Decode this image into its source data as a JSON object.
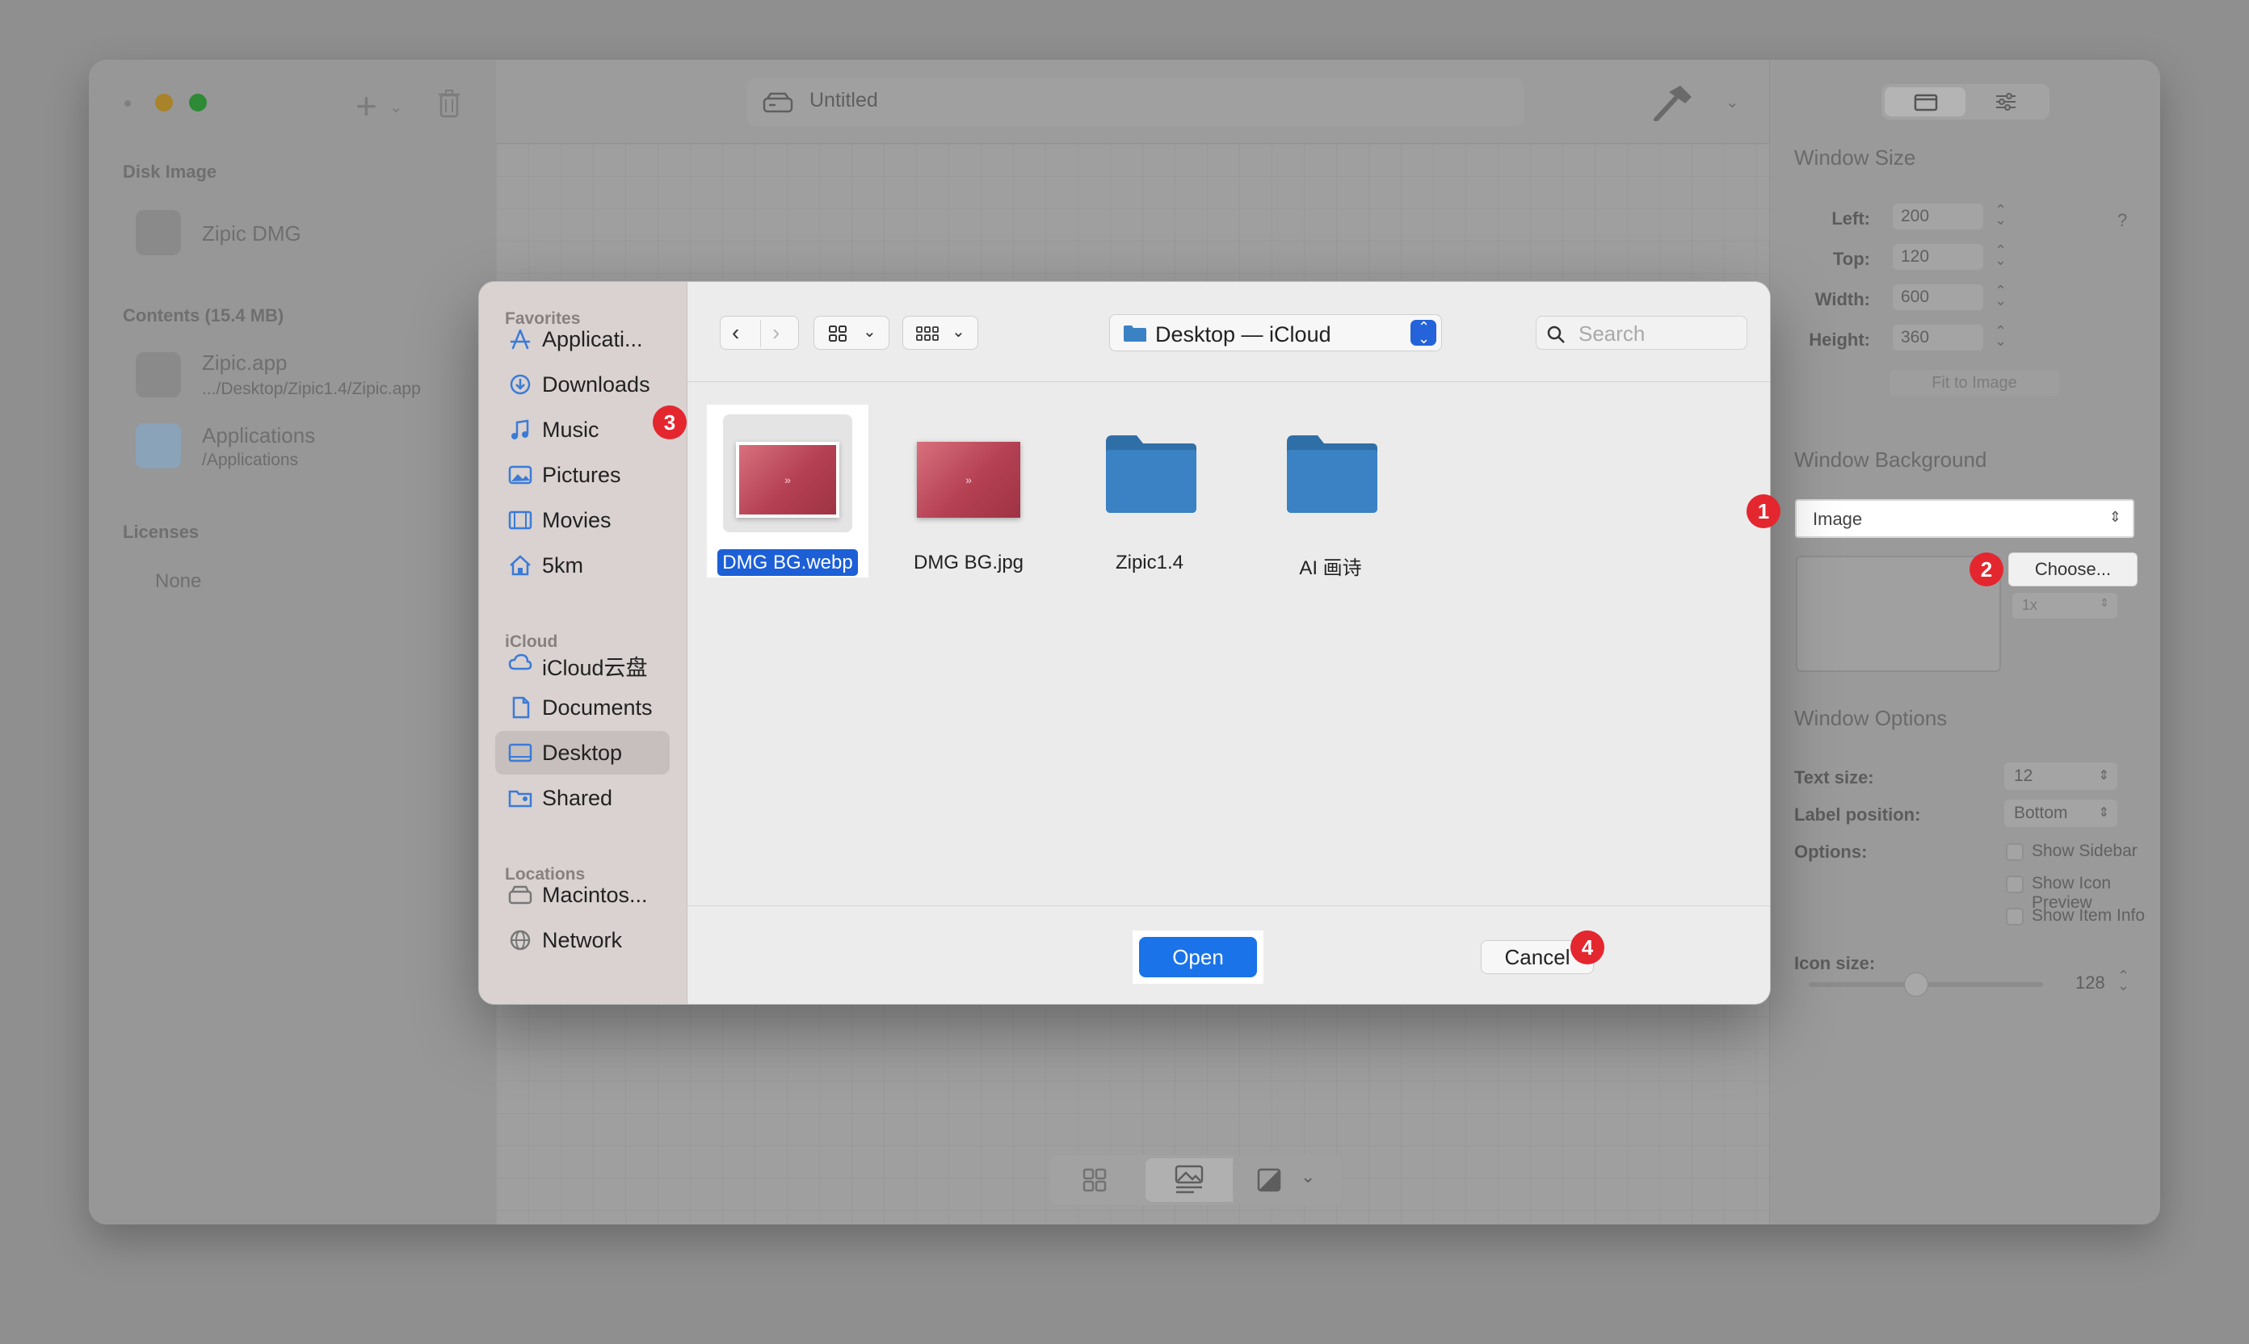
{
  "app": {
    "title": "Untitled",
    "sidebar": {
      "disk_image_header": "Disk Image",
      "disk_image_name": "Zipic DMG",
      "contents_header": "Contents (15.4 MB)",
      "contents": [
        {
          "name": "Zipic.app",
          "path": ".../Desktop/Zipic1.4/Zipic.app"
        },
        {
          "name": "Applications",
          "path": "/Applications"
        }
      ],
      "licenses_header": "Licenses",
      "licenses_value": "None"
    },
    "inspector": {
      "window_size_title": "Window Size",
      "fields": [
        {
          "label": "Left:",
          "value": "200"
        },
        {
          "label": "Top:",
          "value": "120"
        },
        {
          "label": "Width:",
          "value": "600"
        },
        {
          "label": "Height:",
          "value": "360"
        }
      ],
      "help": "?",
      "fit_to_image": "Fit to Image",
      "window_background_title": "Window Background",
      "background_type": "Image",
      "choose_label": "Choose...",
      "scale_value": "1x",
      "window_options_title": "Window Options",
      "text_size_label": "Text size:",
      "text_size_value": "12",
      "label_position_label": "Label position:",
      "label_position_value": "Bottom",
      "options_label": "Options:",
      "options": [
        "Show Sidebar",
        "Show Icon Preview",
        "Show Item Info"
      ],
      "icon_size_label": "Icon size:",
      "icon_size_value": "128",
      "icon_size_fraction": 0.46
    }
  },
  "dialog": {
    "favorites_header": "Favorites",
    "favorites": [
      "Applicati...",
      "Downloads",
      "Music",
      "Pictures",
      "Movies",
      "5km"
    ],
    "icloud_header": "iCloud",
    "icloud": [
      "iCloud云盘",
      "Documents",
      "Desktop",
      "Shared"
    ],
    "locations_header": "Locations",
    "locations": [
      "Macintos...",
      "Network"
    ],
    "path_label": "Desktop — iCloud",
    "search_placeholder": "Search",
    "files": [
      {
        "name": "DMG BG.webp",
        "kind": "image",
        "selected": true
      },
      {
        "name": "DMG BG.jpg",
        "kind": "image",
        "selected": false
      },
      {
        "name": "Zipic1.4",
        "kind": "folder",
        "selected": false
      },
      {
        "name": "AI 画诗",
        "kind": "folder",
        "selected": false
      }
    ],
    "cancel_label": "Cancel",
    "open_label": "Open"
  },
  "badges": [
    "1",
    "2",
    "3",
    "4"
  ],
  "colors": {
    "accent": "#1a73e8",
    "selection": "#1c5fd6",
    "badge": "#e4262f",
    "folder": "#3a82c4"
  }
}
